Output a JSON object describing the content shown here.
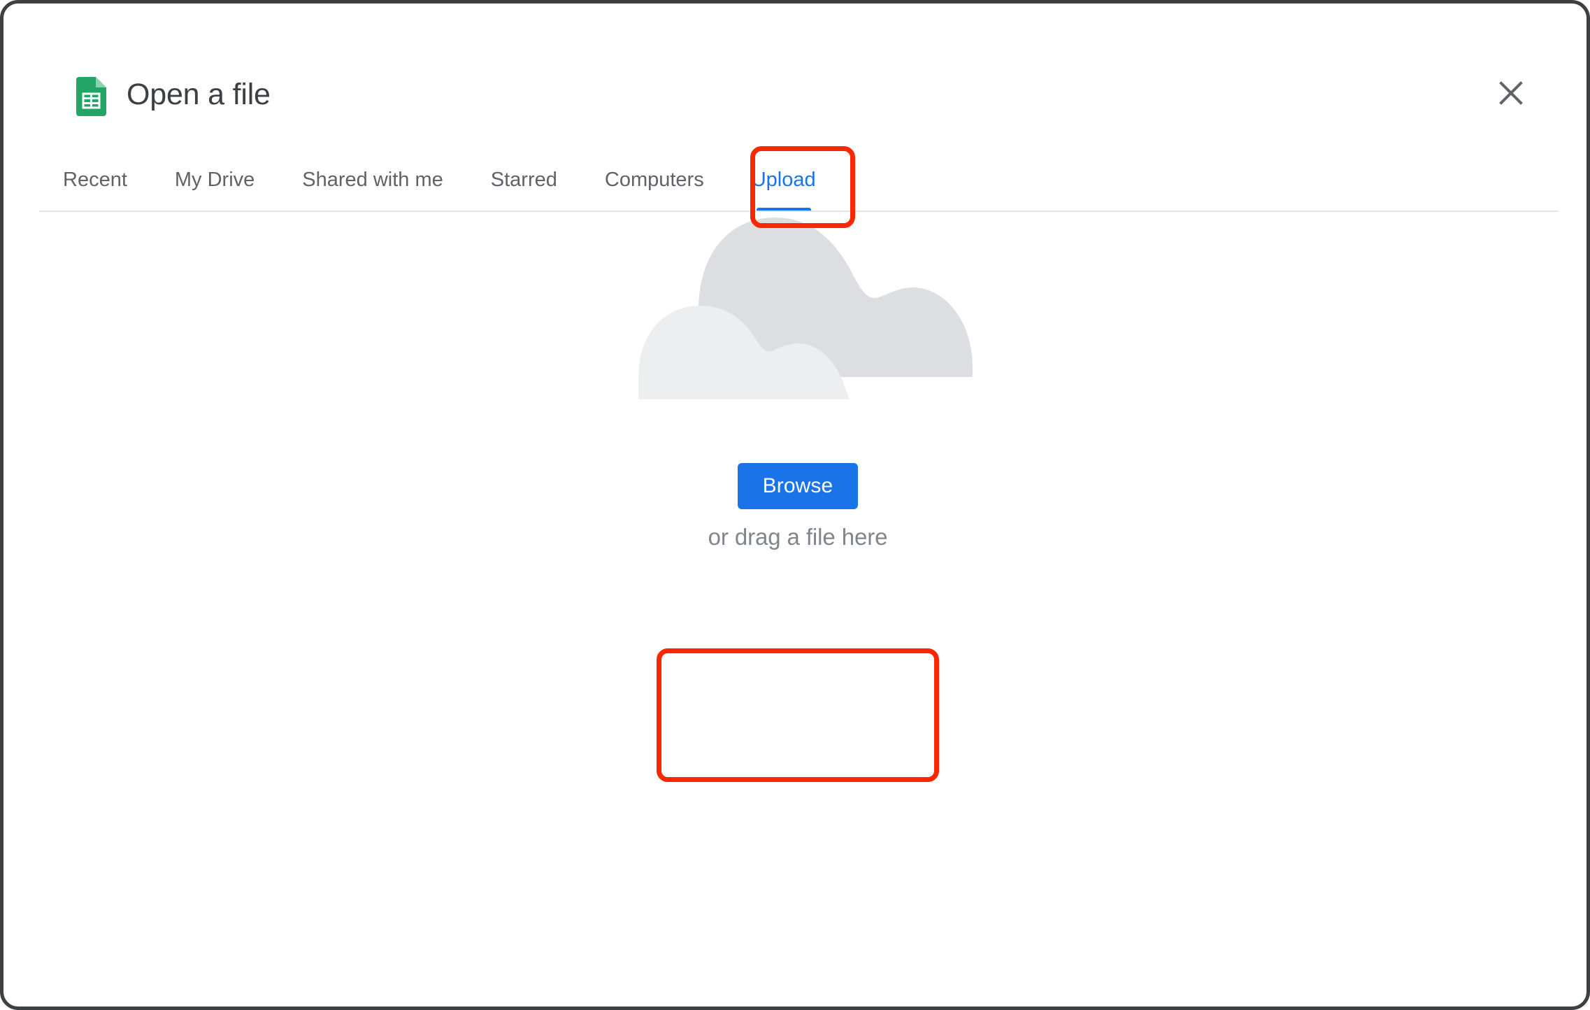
{
  "window": {
    "frame_color": "#3c4043",
    "background": "#ffffff"
  },
  "header": {
    "title": "Open a file",
    "app_icon": "google-sheets-icon",
    "close_icon": "close-icon",
    "title_color": "#3c4043"
  },
  "tabs": {
    "active_index": 5,
    "active_color": "#1a73e8",
    "inactive_color": "#5f6368",
    "items": [
      {
        "label": "Recent",
        "active": false
      },
      {
        "label": "My Drive",
        "active": false
      },
      {
        "label": "Shared with me",
        "active": false
      },
      {
        "label": "Starred",
        "active": false
      },
      {
        "label": "Computers",
        "active": false
      },
      {
        "label": "Upload",
        "active": true
      }
    ]
  },
  "upload": {
    "illustration": "cloud-illustration",
    "browse_label": "Browse",
    "browse_color": "#1a73e8",
    "drag_hint": "or drag a file here",
    "drag_hint_color": "#80868b"
  },
  "annotations": {
    "color": "#fa2800",
    "regions": [
      {
        "name": "upload-tab",
        "target": "Upload"
      },
      {
        "name": "drop-target",
        "target": "Browse or drag a file here"
      }
    ]
  }
}
